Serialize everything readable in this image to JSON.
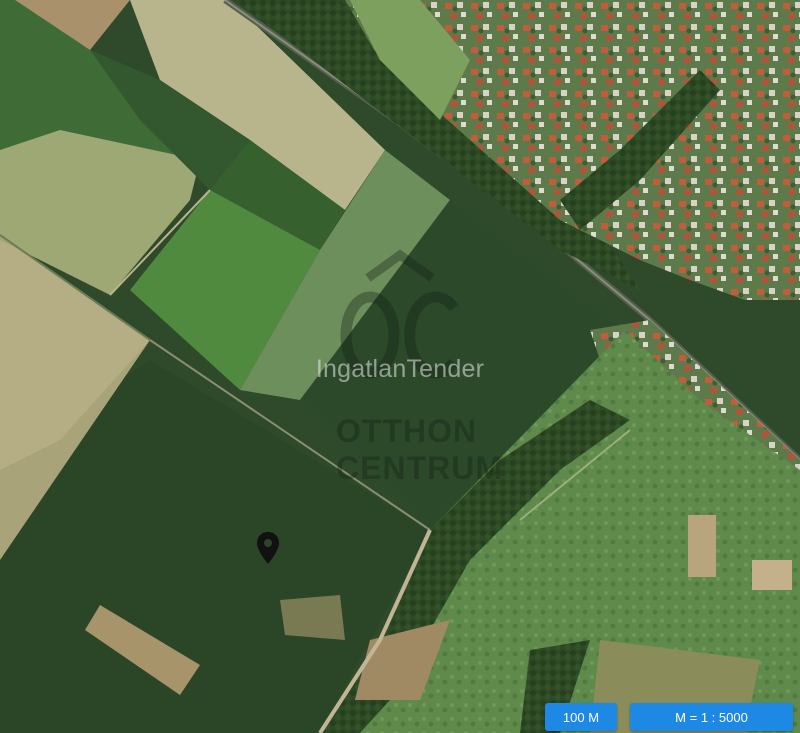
{
  "map": {
    "watermark_text": "IngatlanTender",
    "watermark_brand_line1": "OTTHON",
    "watermark_brand_line2": "CENTRUM",
    "marker_icon": "map-pin-icon"
  },
  "controls": {
    "scale_distance_label": "100 M",
    "scale_ratio_label": "M = 1 : 5000",
    "accent_color": "#1e88e5"
  }
}
